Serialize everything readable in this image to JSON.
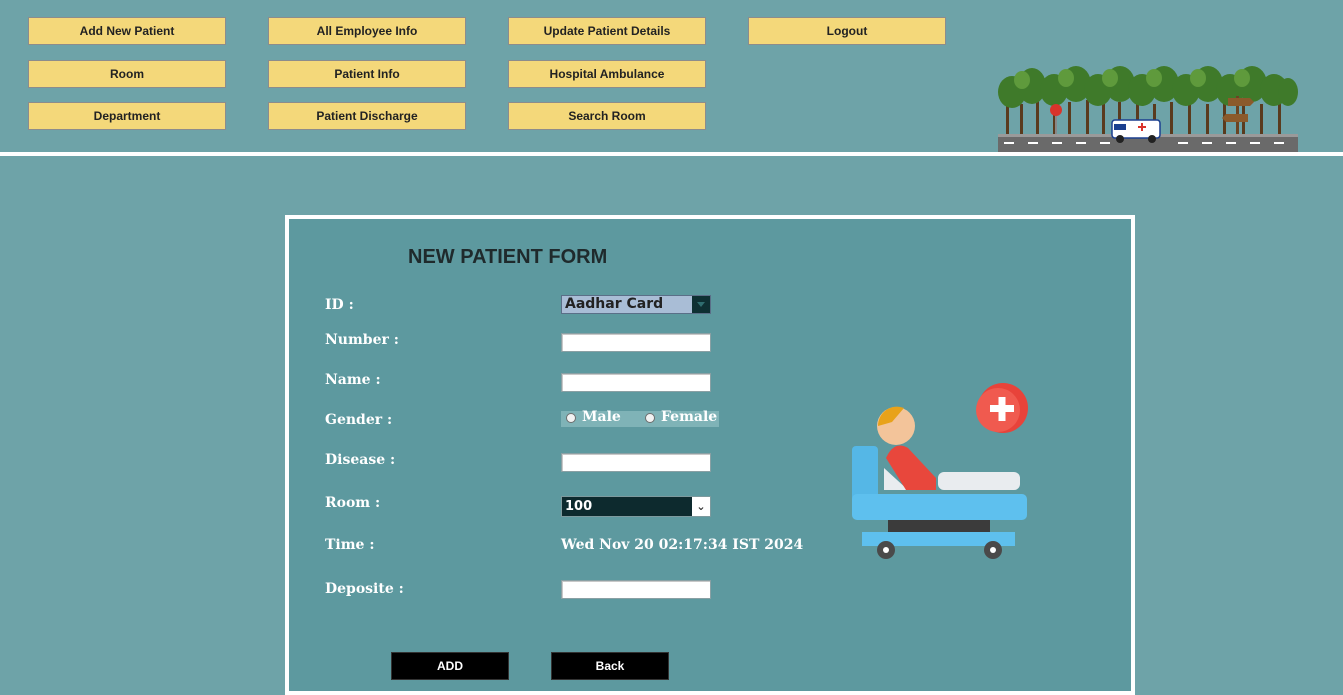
{
  "nav": {
    "add_new_patient": "Add New Patient",
    "all_employee_info": "All Employee Info",
    "update_patient_details": "Update Patient Details",
    "logout": "Logout",
    "room": "Room",
    "patient_info": "Patient Info",
    "hospital_ambulance": "Hospital Ambulance",
    "department": "Department",
    "patient_discharge": "Patient Discharge",
    "search_room": "Search Room"
  },
  "form": {
    "title": "NEW PATIENT FORM",
    "labels": {
      "id": "ID :",
      "number": "Number :",
      "name": "Name :",
      "gender": "Gender :",
      "disease": "Disease :",
      "room": "Room :",
      "time": "Time :",
      "deposite": "Deposite :"
    },
    "id_selected": "Aadhar Card",
    "number_value": "",
    "name_value": "",
    "gender_options": [
      "Male",
      "Female"
    ],
    "disease_value": "",
    "room_selected": "100",
    "time_value": "Wed Nov 20 02:17:34 IST 2024",
    "deposite_value": ""
  },
  "buttons": {
    "add": "ADD",
    "back": "Back"
  },
  "colors": {
    "background": "#6ea3a8",
    "panel": "#5d999f",
    "nav_button": "#f4d87a",
    "action_button": "#000000"
  }
}
